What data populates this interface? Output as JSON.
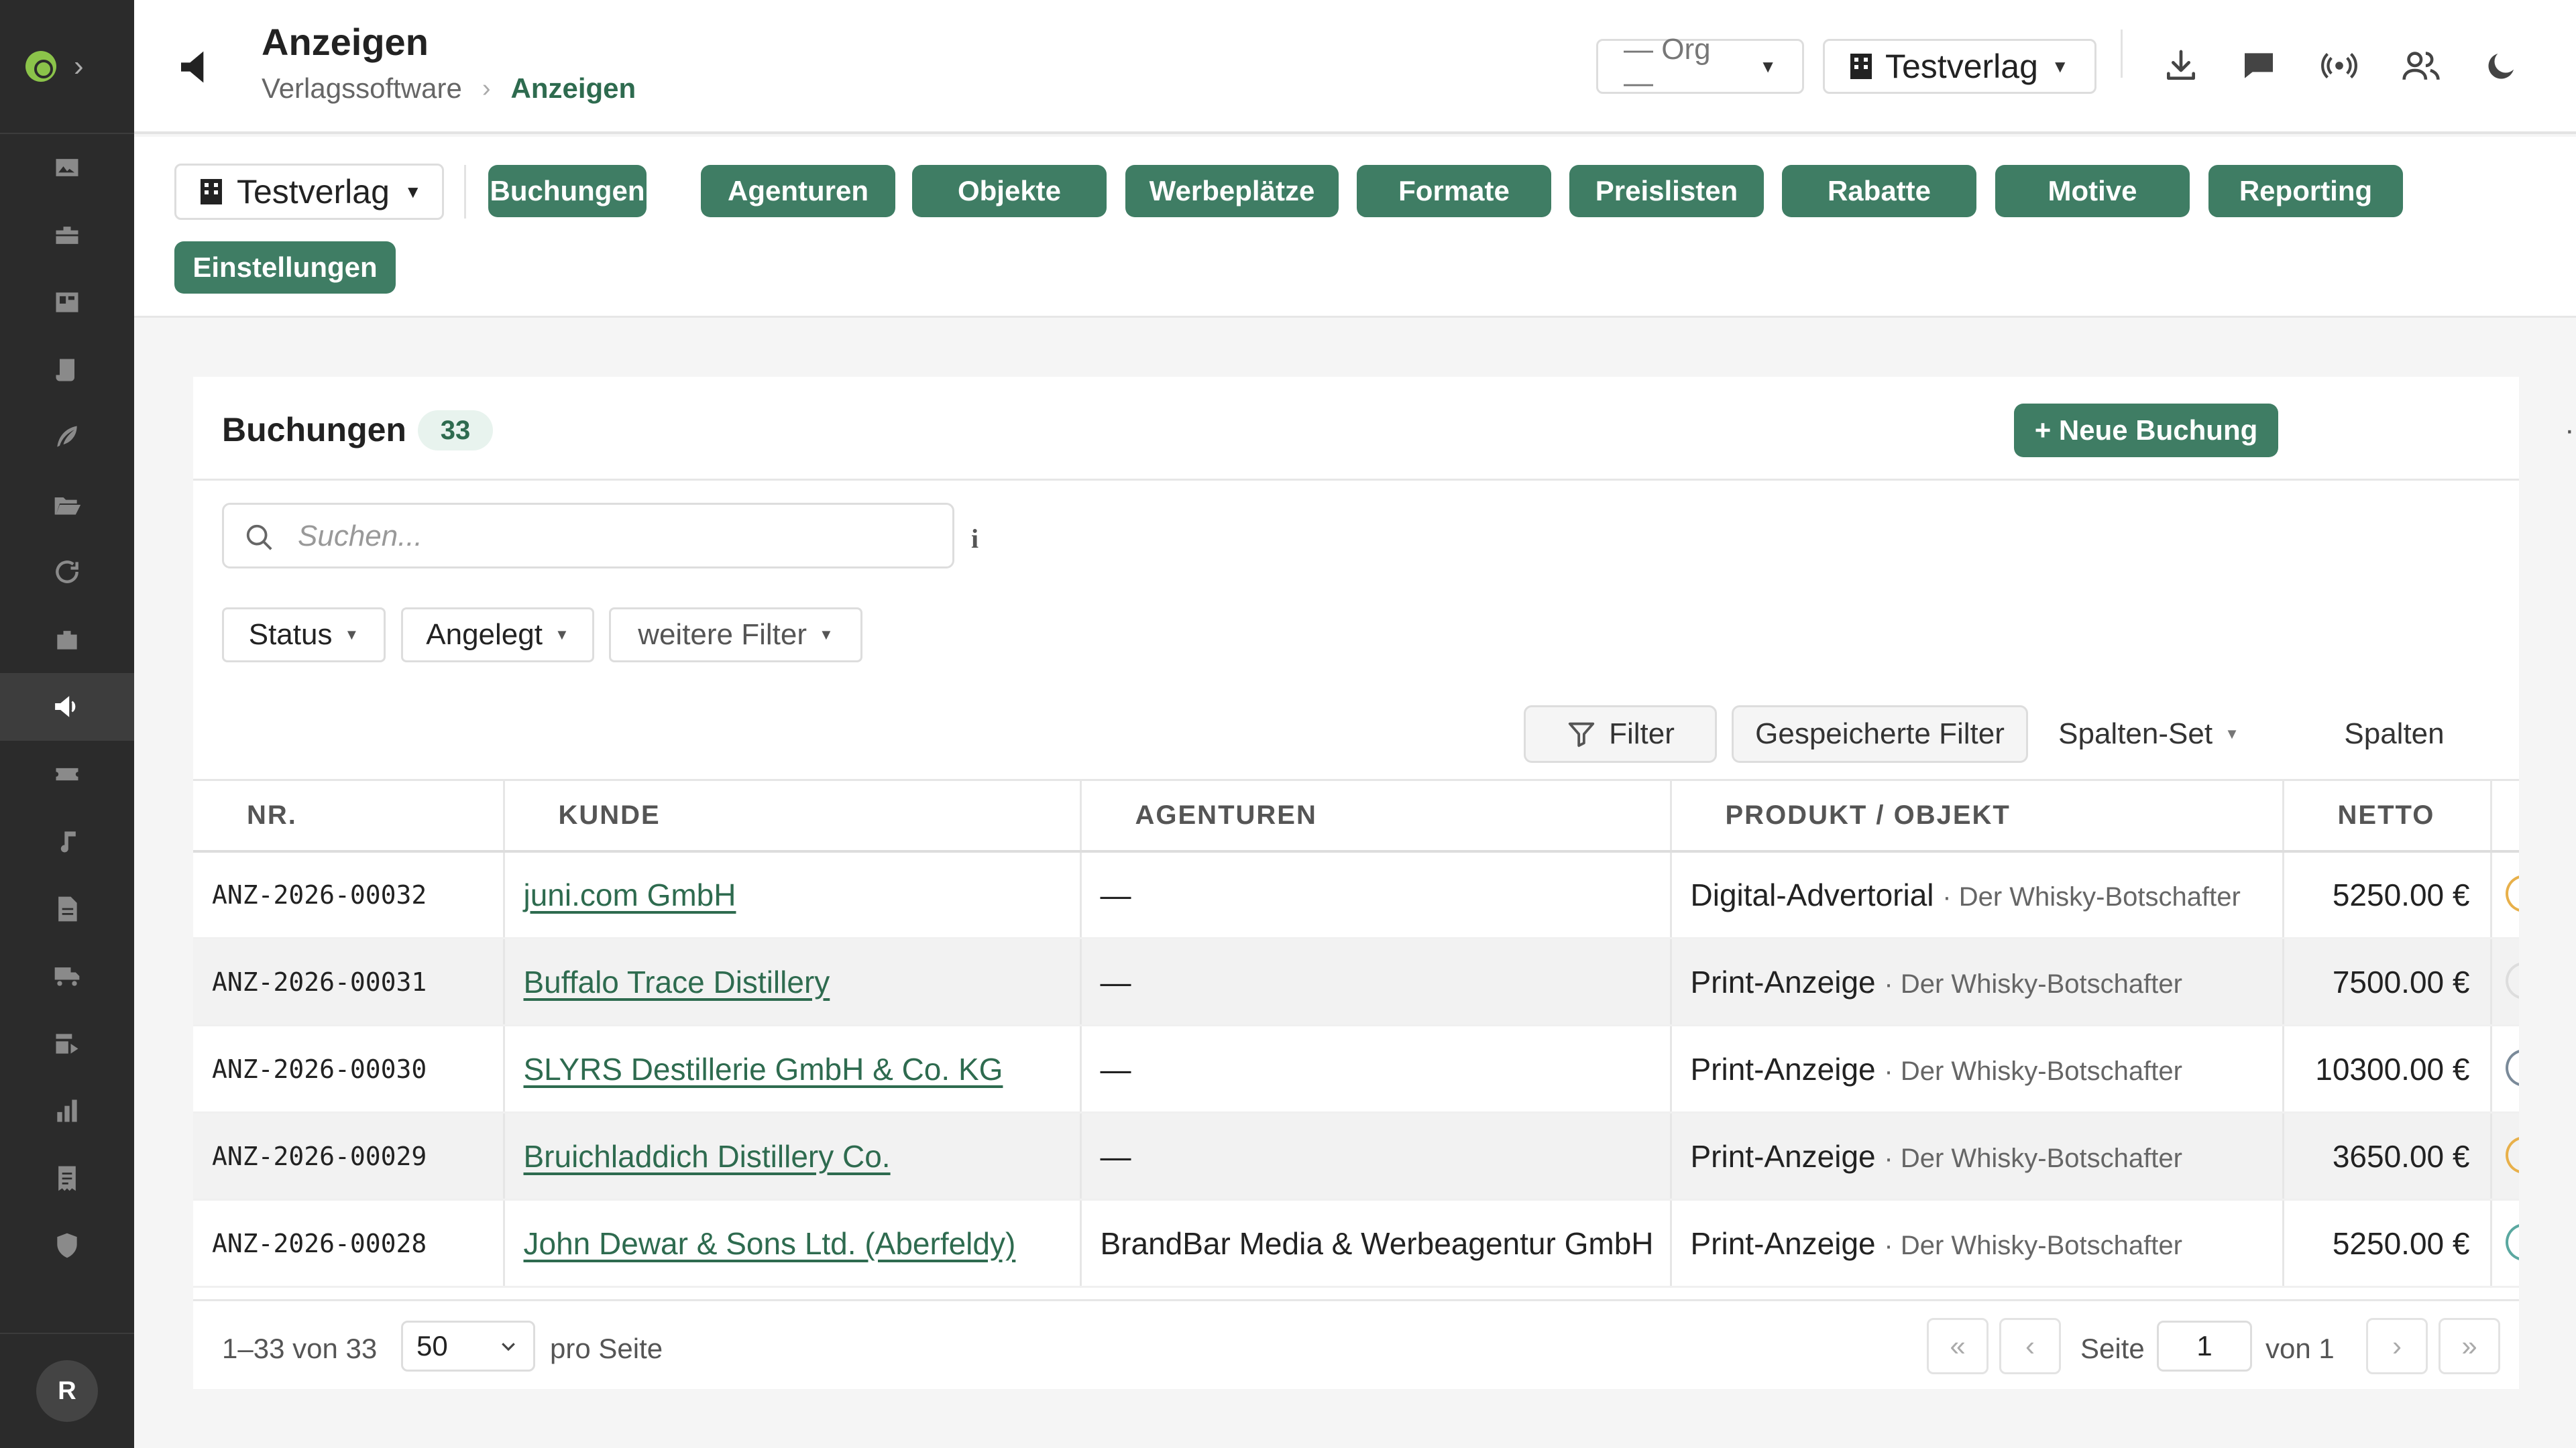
{
  "sidebar": {
    "items": [
      {
        "icon": "image-icon"
      },
      {
        "icon": "briefcase-icon"
      },
      {
        "icon": "board-icon"
      },
      {
        "icon": "scroll-icon"
      },
      {
        "icon": "quill-icon"
      },
      {
        "icon": "folder-open-icon"
      },
      {
        "icon": "refresh-icon"
      },
      {
        "icon": "suitcase-icon"
      },
      {
        "icon": "megaphone-icon",
        "active": true
      },
      {
        "icon": "ticket-icon"
      },
      {
        "icon": "music-note-icon"
      },
      {
        "icon": "document-icon"
      },
      {
        "icon": "truck-icon"
      },
      {
        "icon": "share-icon"
      },
      {
        "icon": "bar-chart-icon"
      },
      {
        "icon": "receipt-icon"
      },
      {
        "icon": "shield-icon"
      }
    ],
    "avatar_initial": "R"
  },
  "header": {
    "title": "Anzeigen",
    "breadcrumb_parent": "Verlagssoftware",
    "breadcrumb_current": "Anzeigen",
    "org_select": "— Org —",
    "publisher_select": "Testverlag"
  },
  "toolbar": {
    "publisher_select": "Testverlag",
    "tabs": [
      "Buchungen",
      "Agenturen",
      "Objekte",
      "Werbeplätze",
      "Formate",
      "Preislisten",
      "Rabatte",
      "Motive",
      "Reporting",
      "Einstellungen"
    ]
  },
  "card": {
    "title": "Buchungen",
    "count": "33",
    "new_button": "+ Neue Buchung",
    "more": "···",
    "search_placeholder": "Suchen...",
    "info": "i",
    "filters": {
      "status": "Status",
      "created": "Angelegt",
      "more": "weitere Filter"
    },
    "actions": {
      "filter": "Filter",
      "saved": "Gespeicherte Filter",
      "column_set": "Spalten-Set",
      "columns": "Spalten"
    }
  },
  "table": {
    "headers": {
      "nr": "NR.",
      "kunde": "KUNDE",
      "agenturen": "AGENTUREN",
      "produkt": "PRODUKT / OBJEKT",
      "netto": "NETTO"
    },
    "rows": [
      {
        "nr": "ANZ-2026-00032",
        "kunde": "juni.com GmbH",
        "agentur": "—",
        "produkt": "Digital-Advertorial",
        "objekt": "· Der Whisky-Botschafter",
        "netto": "5250.00 €",
        "status_color": "#e8b04a"
      },
      {
        "nr": "ANZ-2026-00031",
        "kunde": "Buffalo Trace Distillery",
        "agentur": "—",
        "produkt": "Print-Anzeige",
        "objekt": "· Der Whisky-Botschafter",
        "netto": "7500.00 €",
        "status_color": "#dddddd"
      },
      {
        "nr": "ANZ-2026-00030",
        "kunde": "SLYRS Destillerie GmbH & Co. KG",
        "agentur": "—",
        "produkt": "Print-Anzeige",
        "objekt": "· Der Whisky-Botschafter",
        "netto": "10300.00 €",
        "status_color": "#7a8a99"
      },
      {
        "nr": "ANZ-2026-00029",
        "kunde": "Bruichladdich Distillery Co.",
        "agentur": "—",
        "produkt": "Print-Anzeige",
        "objekt": "· Der Whisky-Botschafter",
        "netto": "3650.00 €",
        "status_color": "#e8b04a"
      },
      {
        "nr": "ANZ-2026-00028",
        "kunde": "John Dewar & Sons Ltd. (Aberfeldy)",
        "agentur": "BrandBar Media & Werbeagentur GmbH",
        "produkt": "Print-Anzeige",
        "objekt": "· Der Whisky-Botschafter",
        "netto": "5250.00 €",
        "status_color": "#5aa8a0"
      }
    ]
  },
  "pagination": {
    "range": "1–33 von 33",
    "per_page": "50",
    "per_page_label": "pro Seite",
    "first": "«",
    "prev": "‹",
    "page_label": "Seite",
    "page": "1",
    "of_label": "von 1",
    "next": "›",
    "last": "»"
  }
}
